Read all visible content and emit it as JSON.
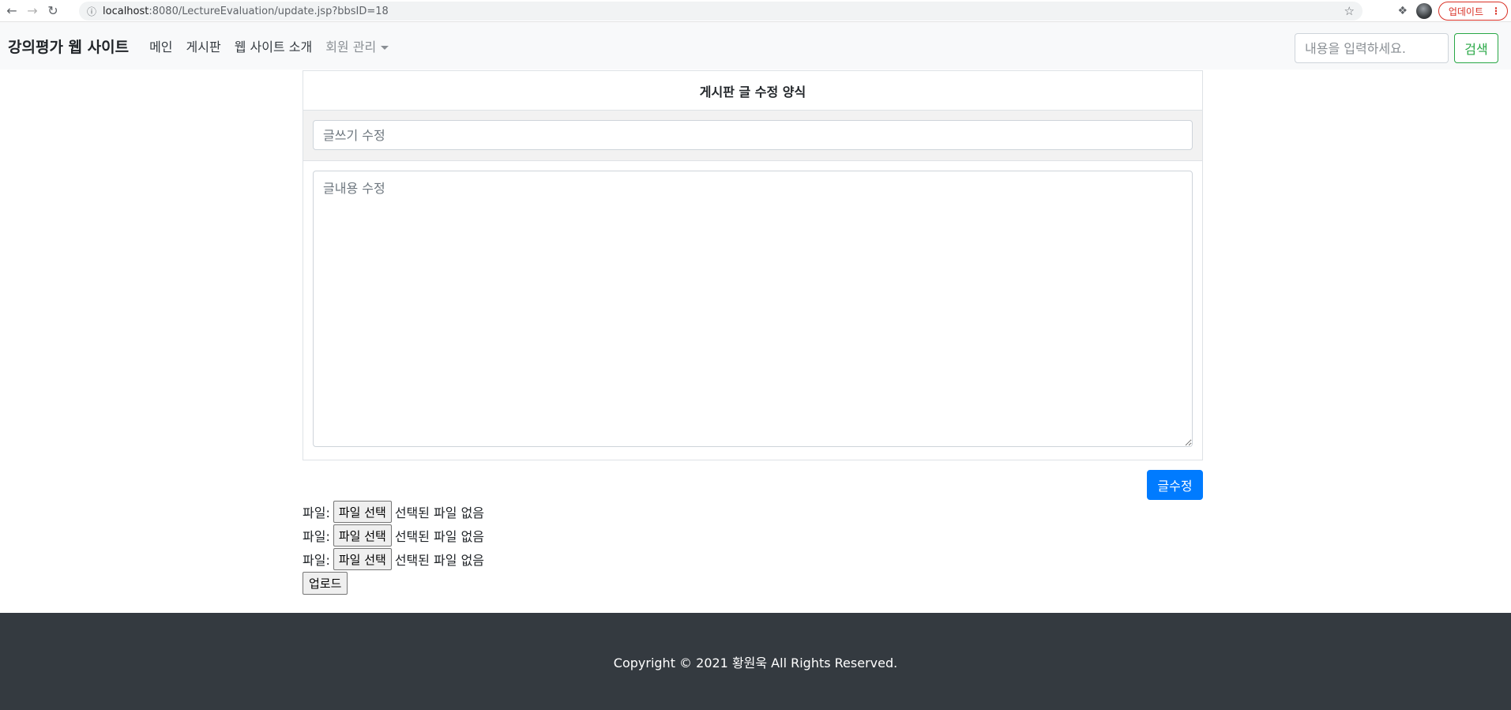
{
  "browser": {
    "url_host": "localhost",
    "url_path": ":8080/LectureEvaluation/update.jsp?bbsID=18",
    "update_label": "업데이트"
  },
  "navbar": {
    "brand": "강의평가 웹 사이트",
    "links": [
      "메인",
      "게시판",
      "웹 사이트 소개"
    ],
    "dropdown_label": "회원 관리",
    "search_placeholder": "내용을 입력하세요.",
    "search_button": "검색"
  },
  "form": {
    "header": "게시판 글 수정 양식",
    "title_placeholder": "글쓰기 수정",
    "content_placeholder": "글내용 수정",
    "submit_label": "글수정"
  },
  "files": {
    "label": "파일:",
    "choose_label": "파일 선택",
    "none_selected": "선택된 파일 없음",
    "upload_label": "업로드"
  },
  "footer": {
    "text": "Copyright © 2021 황원욱 All Rights Reserved."
  }
}
